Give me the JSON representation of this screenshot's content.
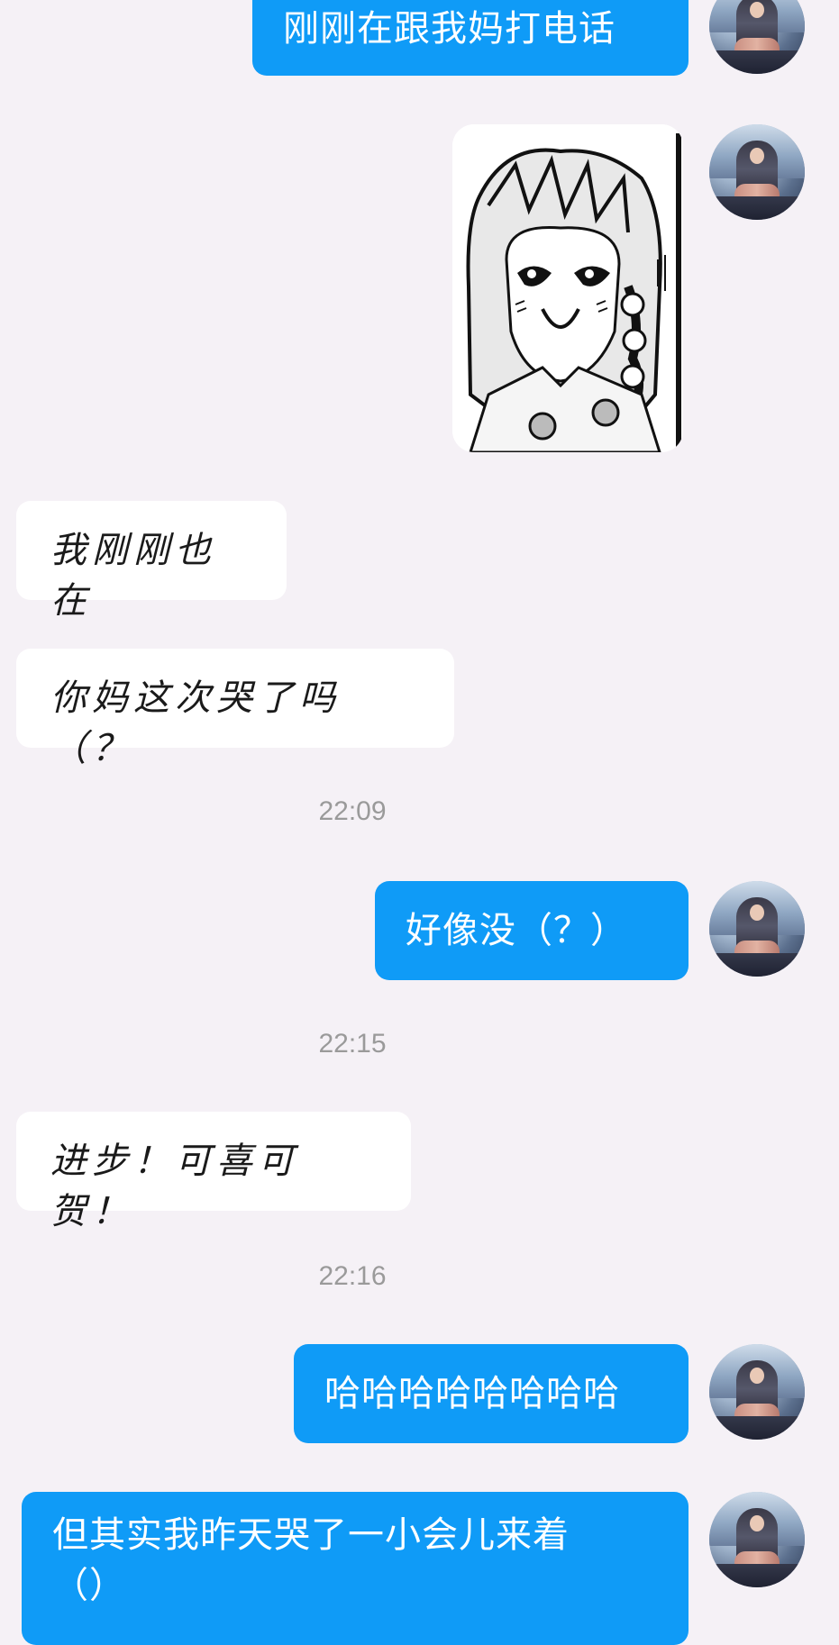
{
  "messages": [
    {
      "side": "right",
      "text": "刚刚在跟我妈打电话"
    },
    {
      "side": "right",
      "type": "sticker",
      "icon": "anime-girl-smiling-sticker"
    },
    {
      "side": "left",
      "text": "我刚刚也在"
    },
    {
      "side": "left",
      "text": "你妈这次哭了吗（？"
    },
    {
      "type": "time",
      "text": "22:09"
    },
    {
      "side": "right",
      "text": "好像没（？）"
    },
    {
      "type": "time",
      "text": "22:15"
    },
    {
      "side": "left",
      "text": "进步！可喜可贺！"
    },
    {
      "type": "time",
      "text": "22:16"
    },
    {
      "side": "right",
      "text": "哈哈哈哈哈哈哈哈"
    },
    {
      "side": "right",
      "text_lines": [
        "但其实我昨天哭了一小会儿来着",
        "（）"
      ]
    }
  ],
  "colors": {
    "background": "#f5f1f6",
    "outgoing_bubble": "#0f9bf7",
    "incoming_bubble": "#ffffff",
    "time_text": "#9a9a9a"
  }
}
